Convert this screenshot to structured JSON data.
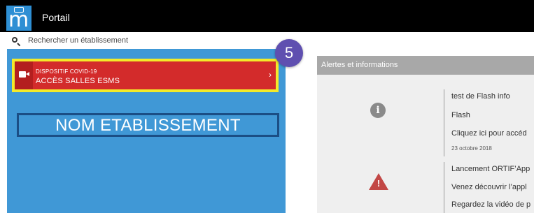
{
  "app": {
    "title": "Portail"
  },
  "search": {
    "placeholder": "Rechercher un établissement"
  },
  "covid_card": {
    "title": "DISPOSITIF COVID-19",
    "subtitle": "ACCÈS SALLES ESMS",
    "chevron": "›"
  },
  "step_badge": {
    "label": "5"
  },
  "establishment": {
    "name": "NOM ETABLISSEMENT"
  },
  "alerts": {
    "header": "Alertes et informations",
    "items": [
      {
        "icon": "info-icon",
        "lines": [
          "test de Flash info",
          "Flash",
          "Cliquez ici pour accéd"
        ],
        "date": "23 octobre 2018"
      },
      {
        "icon": "warning-icon",
        "lines": [
          "Lancement ORTIF’App",
          "Venez découvrir l’appl",
          "Regardez la vidéo de p"
        ],
        "date": ""
      }
    ]
  },
  "colors": {
    "topbar": "#000000",
    "logo": "#2e8fd4",
    "left_panel": "#4098d6",
    "covid_card": "#d32b2b",
    "highlight_border": "#f3ea2a",
    "badge": "#5f4fb0",
    "name_border": "#1b4e85",
    "right_header": "#a8a8a8",
    "right_panel": "#efefef",
    "warning": "#c24745"
  }
}
